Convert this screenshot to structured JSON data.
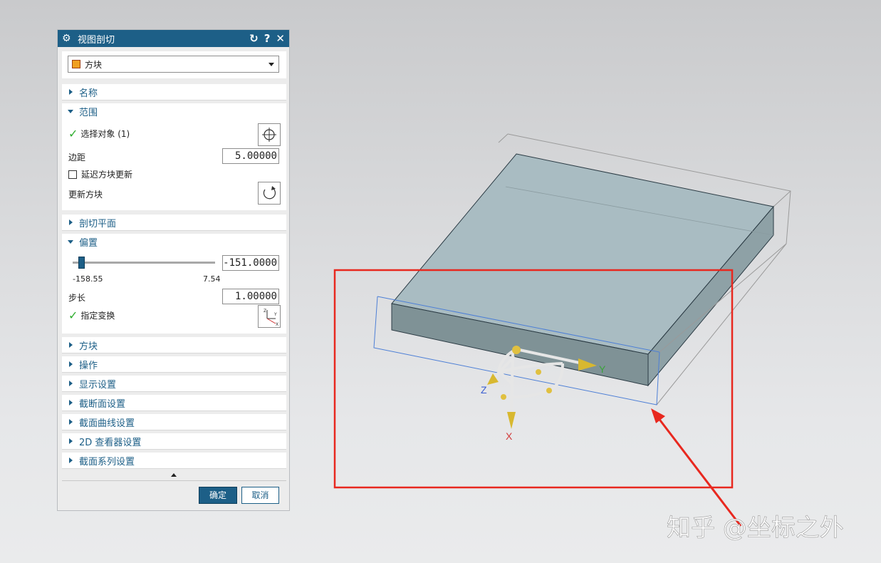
{
  "dialog": {
    "title": "视图剖切",
    "title_buttons": [
      "↻",
      "?",
      "✕"
    ],
    "type_select": {
      "value": "方块"
    },
    "sections": {
      "name": "名称",
      "range": "范围",
      "cut_plane": "剖切平面",
      "offset": "偏置",
      "block": "方块",
      "operation": "操作",
      "display": "显示设置",
      "section_settings": "截断面设置",
      "curve_settings": "截面曲线设置",
      "viewer_2d": "2D 查看器设置",
      "series_settings": "截面系列设置"
    },
    "range": {
      "select_object": "选择对象 (1)",
      "margin_label": "边距",
      "margin_value": "5.00000",
      "delay_update_label": "延迟方块更新",
      "update_block_label": "更新方块"
    },
    "offset": {
      "slider_min": "-158.55",
      "slider_max": "7.54",
      "slider_fraction": 0.045,
      "value": "-151.0000",
      "step_label": "步长",
      "step_value": "1.00000",
      "transform_label": "指定变换"
    },
    "ok": "确定",
    "cancel": "取消"
  },
  "viewport": {
    "axis_x": "X",
    "axis_y": "Y",
    "axis_z": "Z",
    "watermark": "知乎 @坐标之外"
  },
  "colors": {
    "accent": "#1d5f87",
    "highlight": "#e8281f",
    "check": "#2fae2f"
  }
}
